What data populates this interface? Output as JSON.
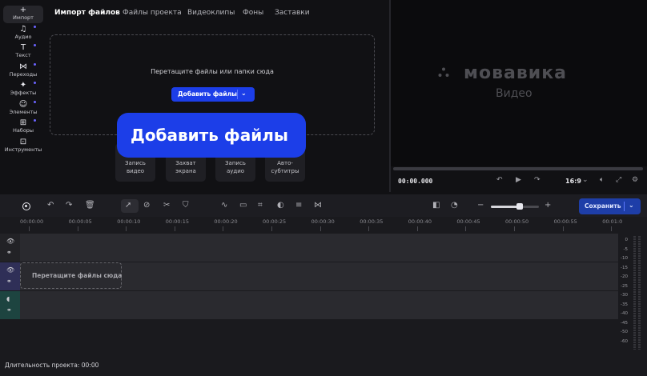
{
  "rail": [
    {
      "icon": "+",
      "label": "Импорт",
      "name": "rail-import",
      "active": true,
      "dot": false
    },
    {
      "icon": "♫",
      "label": "Аудио",
      "name": "rail-audio",
      "dot": true
    },
    {
      "icon": "T",
      "label": "Текст",
      "name": "rail-text",
      "dot": true
    },
    {
      "icon": "⋈",
      "label": "Переходы",
      "name": "rail-transitions",
      "dot": true
    },
    {
      "icon": "✦",
      "label": "Эффекты",
      "name": "rail-effects",
      "dot": true
    },
    {
      "icon": "☺",
      "label": "Элементы",
      "name": "rail-elements",
      "dot": true
    },
    {
      "icon": "⊞",
      "label": "Наборы",
      "name": "rail-sets",
      "dot": true
    },
    {
      "icon": "⊡",
      "label": "Инструменты",
      "name": "rail-tools",
      "dot": false
    }
  ],
  "import_tabs": [
    "Импорт файлов",
    "Файлы проекта",
    "Видеоклипы",
    "Фоны",
    "Заставки"
  ],
  "dropzone": {
    "text": "Перетащите файлы или папки сюда",
    "add_button": "Добавить файлы"
  },
  "capture_cards": [
    "Запись\nвидео",
    "Захват\nэкрана",
    "Запись\nаудио",
    "Авто-\nсубтитры"
  ],
  "callout": "Добавить файлы",
  "preview": {
    "logo": "мовавика",
    "logo_sub": "Видео",
    "timecode": "00:00.000",
    "aspect": "16:9"
  },
  "toolbar": {
    "save_label": "Сохранить"
  },
  "ruler_ticks": [
    "00:00:00",
    "00:00:05",
    "00:00:10",
    "00:00:15",
    "00:00:20",
    "00:00:25",
    "00:00:30",
    "00:00:35",
    "00:00:40",
    "00:00:45",
    "00:00:50",
    "00:00:55",
    "00:01:0"
  ],
  "drop_clip": "Перетащите файлы сюда",
  "meter_labels": [
    "0",
    "-5",
    "-10",
    "-15",
    "-20",
    "-25",
    "-30",
    "-35",
    "-40",
    "-45",
    "-50",
    "-60"
  ],
  "zoom": {
    "level": 0.58
  },
  "status": "Длительность проекта: 00:00",
  "colors": {
    "accent": "#1c3ee8",
    "bg": "#111114",
    "timeline": "#1a1a1e"
  }
}
